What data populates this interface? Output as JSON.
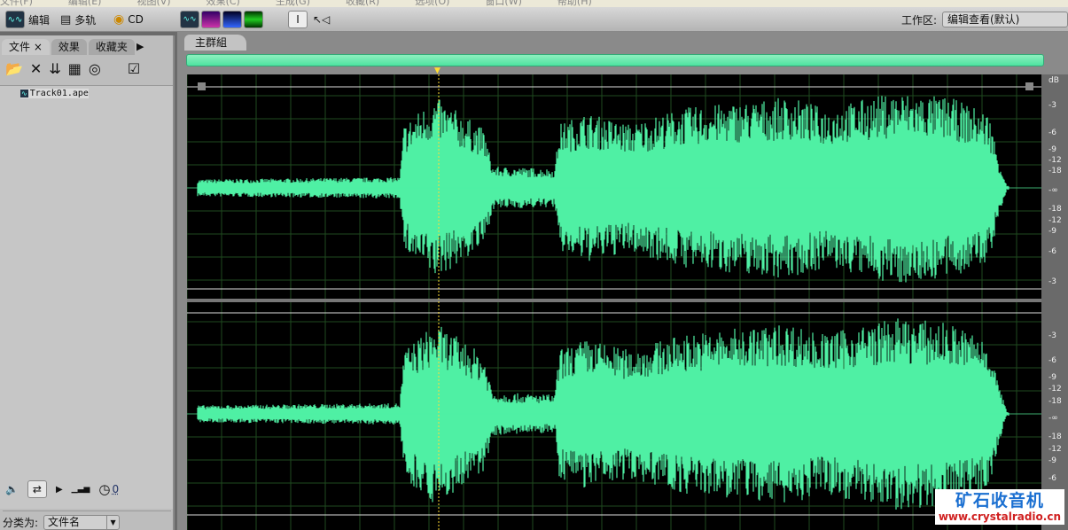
{
  "menu": [
    "文件(F)",
    "编辑(E)",
    "视图(V)",
    "效果(C)",
    "生成(G)",
    "收藏(R)",
    "选项(O)",
    "窗口(W)",
    "帮助(H)"
  ],
  "toolbar": {
    "edit": "编辑",
    "multitrack": "多轨",
    "cd": "CD",
    "workspace_label": "工作区:",
    "workspace_value": "编辑查看(默认)"
  },
  "left_panel": {
    "tabs": [
      "文件",
      "效果",
      "收藏夹"
    ],
    "close": "×",
    "files": [
      "Track01.ape"
    ],
    "volume_value": "0",
    "sort_label": "分类为:",
    "sort_value": "文件名"
  },
  "editor": {
    "tab": "主群組",
    "db_label": "dB",
    "ruler_top": [
      "-3",
      "-6",
      "-9",
      "-12",
      "-18",
      "-∞",
      "-18",
      "-12",
      "-9",
      "-6",
      "-3"
    ],
    "ruler_bottom": [
      "-3",
      "-6",
      "-9",
      "-12",
      "-18",
      "-∞",
      "-18",
      "-12",
      "-9",
      "-6"
    ]
  },
  "watermark": {
    "line1": "矿石收音机",
    "line2": "www.crystalradio.cn"
  },
  "colors": {
    "waveform": "#4ff0a4",
    "background": "#000000",
    "grid": "#1f4a1f"
  }
}
